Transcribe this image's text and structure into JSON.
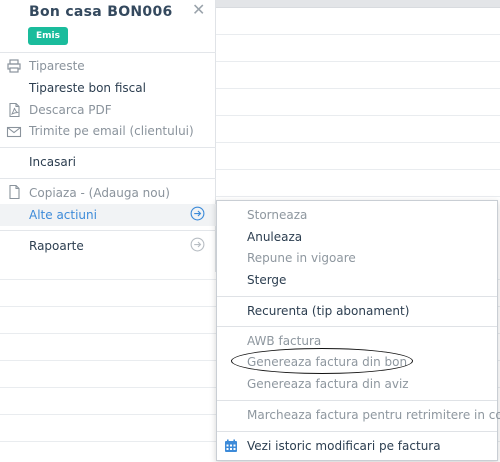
{
  "header": {
    "title": "Bon casa BON006",
    "status_badge": "Emis",
    "badge_color": "#1abc9c"
  },
  "left_menu": {
    "print": "Tipareste",
    "print_fiscal": "Tipareste bon fiscal",
    "download_pdf": "Descarca PDF",
    "email": "Trimite pe email (clientului)",
    "payments": "Incasari",
    "copy": "Copiaza - (Adauga nou)",
    "other_actions": "Alte actiuni",
    "reports": "Rapoarte"
  },
  "submenu": {
    "items": [
      {
        "label": "Storneaza",
        "enabled": false
      },
      {
        "label": "Anuleaza",
        "enabled": true
      },
      {
        "label": "Repune in vigoare",
        "enabled": false
      },
      {
        "label": "Sterge",
        "enabled": true
      },
      {
        "label": "Recurenta (tip abonament)",
        "enabled": true
      },
      {
        "label": "AWB factura",
        "enabled": false
      },
      {
        "label": "Genereaza factura din bon",
        "enabled": false
      },
      {
        "label": "Genereaza factura din aviz",
        "enabled": false
      },
      {
        "label": "Marcheaza factura pentru retrimitere in conta",
        "enabled": false
      },
      {
        "label": "Vezi istoric modificari pe factura",
        "enabled": true
      }
    ]
  },
  "colors": {
    "accent": "#3d8bd9",
    "calendar_icon": "#3d8bd9"
  }
}
